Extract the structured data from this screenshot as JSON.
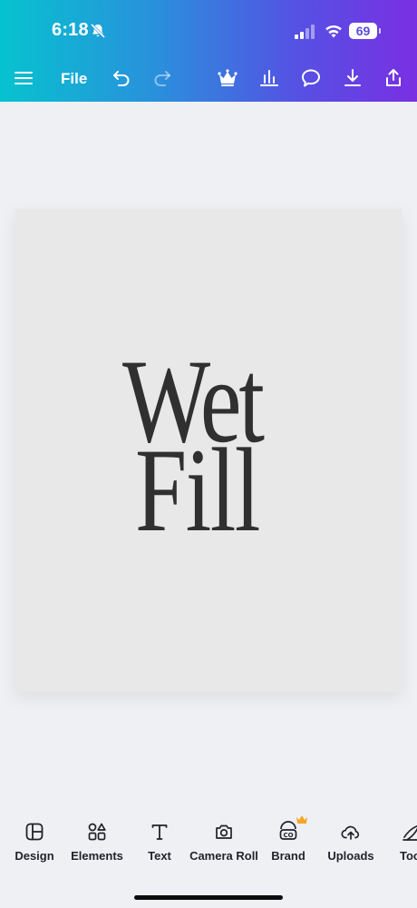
{
  "status_bar": {
    "time": "6:18",
    "battery": "69"
  },
  "toolbar": {
    "file_label": "File",
    "icons": [
      "menu-icon",
      "undo-icon",
      "redo-icon",
      "crown-icon",
      "insights-icon",
      "comment-icon",
      "download-icon",
      "share-icon"
    ]
  },
  "design": {
    "line1": "Wet",
    "line2": "Fill",
    "text_color": "#303030",
    "canvas_color": "#e8e8e9"
  },
  "bottom_tools": [
    {
      "label": "Design",
      "icon": "design-icon"
    },
    {
      "label": "Elements",
      "icon": "elements-icon"
    },
    {
      "label": "Text",
      "icon": "text-icon"
    },
    {
      "label": "Camera Roll",
      "icon": "camera-icon"
    },
    {
      "label": "Brand",
      "icon": "brand-icon"
    },
    {
      "label": "Uploads",
      "icon": "upload-cloud-icon"
    },
    {
      "label": "Too",
      "icon": "tools-icon"
    }
  ],
  "colors": {
    "accent_gradient_start": "#06c3cf",
    "accent_gradient_end": "#7a2fe3",
    "premium_crown": "#f5a524"
  }
}
